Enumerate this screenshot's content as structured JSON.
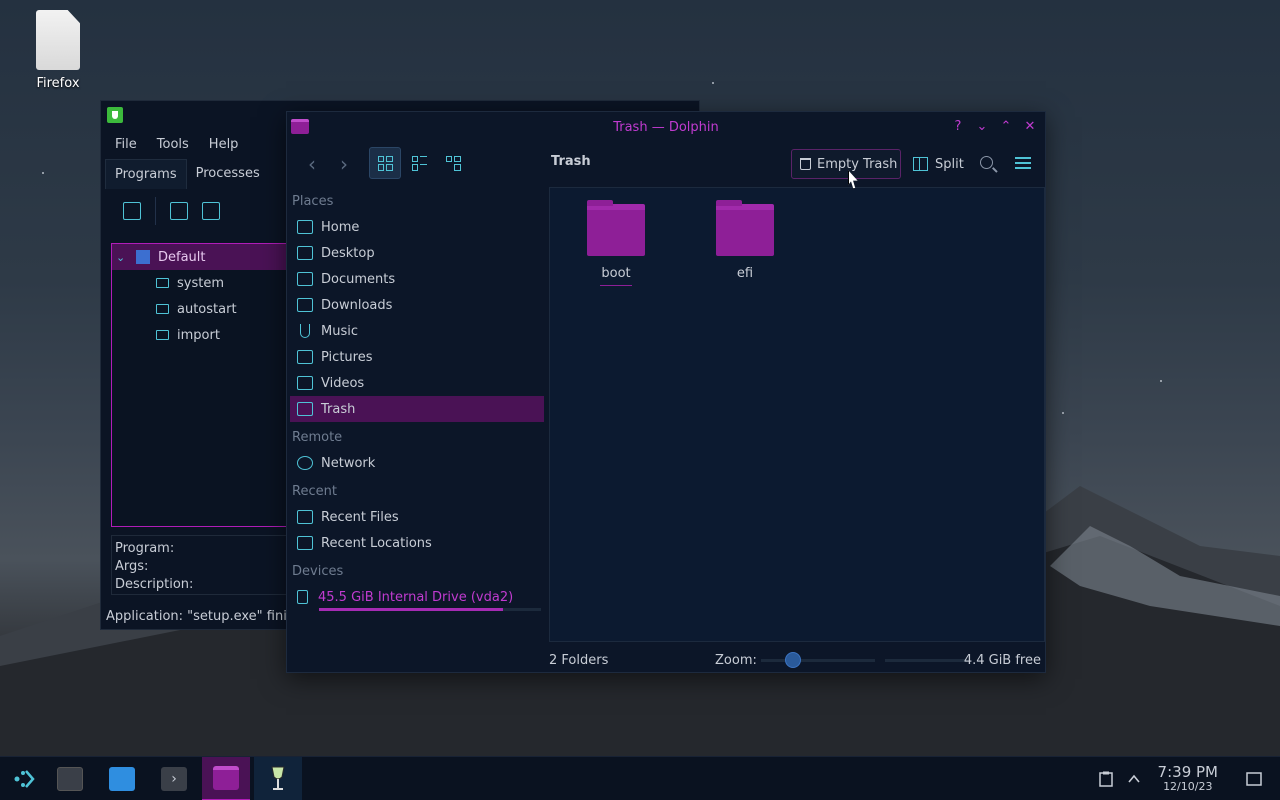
{
  "desktop": {
    "icon_label": "Firefox"
  },
  "winecfg": {
    "menu": [
      "File",
      "Tools",
      "Help"
    ],
    "tabs": [
      "Programs",
      "Processes"
    ],
    "tree": [
      {
        "label": "Default",
        "selected": true
      },
      {
        "label": "system"
      },
      {
        "label": "autostart"
      },
      {
        "label": "import"
      }
    ],
    "info": {
      "program": "Program:",
      "args": "Args:",
      "description": "Description:"
    },
    "status": "Application: \"setup.exe\" finish"
  },
  "dolphin": {
    "title": "Trash — Dolphin",
    "breadcrumb": "Trash",
    "empty_trash": "Empty Trash",
    "split": "Split",
    "places": {
      "places_header": "Places",
      "items": [
        "Home",
        "Desktop",
        "Documents",
        "Downloads",
        "Music",
        "Pictures",
        "Videos",
        "Trash"
      ],
      "remote_header": "Remote",
      "remote_items": [
        "Network"
      ],
      "recent_header": "Recent",
      "recent_items": [
        "Recent Files",
        "Recent Locations"
      ],
      "devices_header": "Devices",
      "device": "45.5 GiB Internal Drive (vda2)",
      "device_usage_fraction": 0.83
    },
    "items": [
      "boot",
      "efi"
    ],
    "status": {
      "count": "2 Folders",
      "zoom_label": "Zoom:",
      "free": "4.4 GiB free"
    }
  },
  "taskbar": {
    "time": "7:39 PM",
    "date": "12/10/23"
  },
  "colors": {
    "accent": "#b01cb8",
    "cyan": "#4fc3d6",
    "selection": "#4a1255",
    "folder": "#8e1f97"
  }
}
